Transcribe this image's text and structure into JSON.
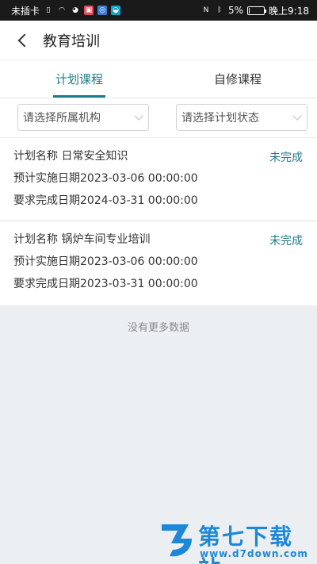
{
  "status_bar": {
    "carrier": "未插卡",
    "battery_percent": "5%",
    "battery_level": 0.05,
    "time": "晚上9:18"
  },
  "header": {
    "title": "教育培训"
  },
  "tabs": [
    {
      "label": "计划课程",
      "active": true
    },
    {
      "label": "自修课程",
      "active": false
    }
  ],
  "filters": {
    "org_placeholder": "请选择所属机构",
    "status_placeholder": "请选择计划状态"
  },
  "plans": [
    {
      "name": "计划名称 日常安全知识",
      "status": "未完成",
      "planned_date": "预计实施日期2023-03-06 00:00:00",
      "due_date": "要求完成日期2024-03-31 00:00:00"
    },
    {
      "name": "计划名称 锅炉车间专业培训",
      "status": "未完成",
      "planned_date": "预计实施日期2023-03-06 00:00:00",
      "due_date": "要求完成日期2023-03-31 00:00:00"
    }
  ],
  "list_footer": "没有更多数据",
  "watermark": {
    "name": "第七下载站",
    "url": "www.d7down.com"
  },
  "colors": {
    "accent": "#1f7c8c",
    "watermark": "#1e88d6"
  }
}
